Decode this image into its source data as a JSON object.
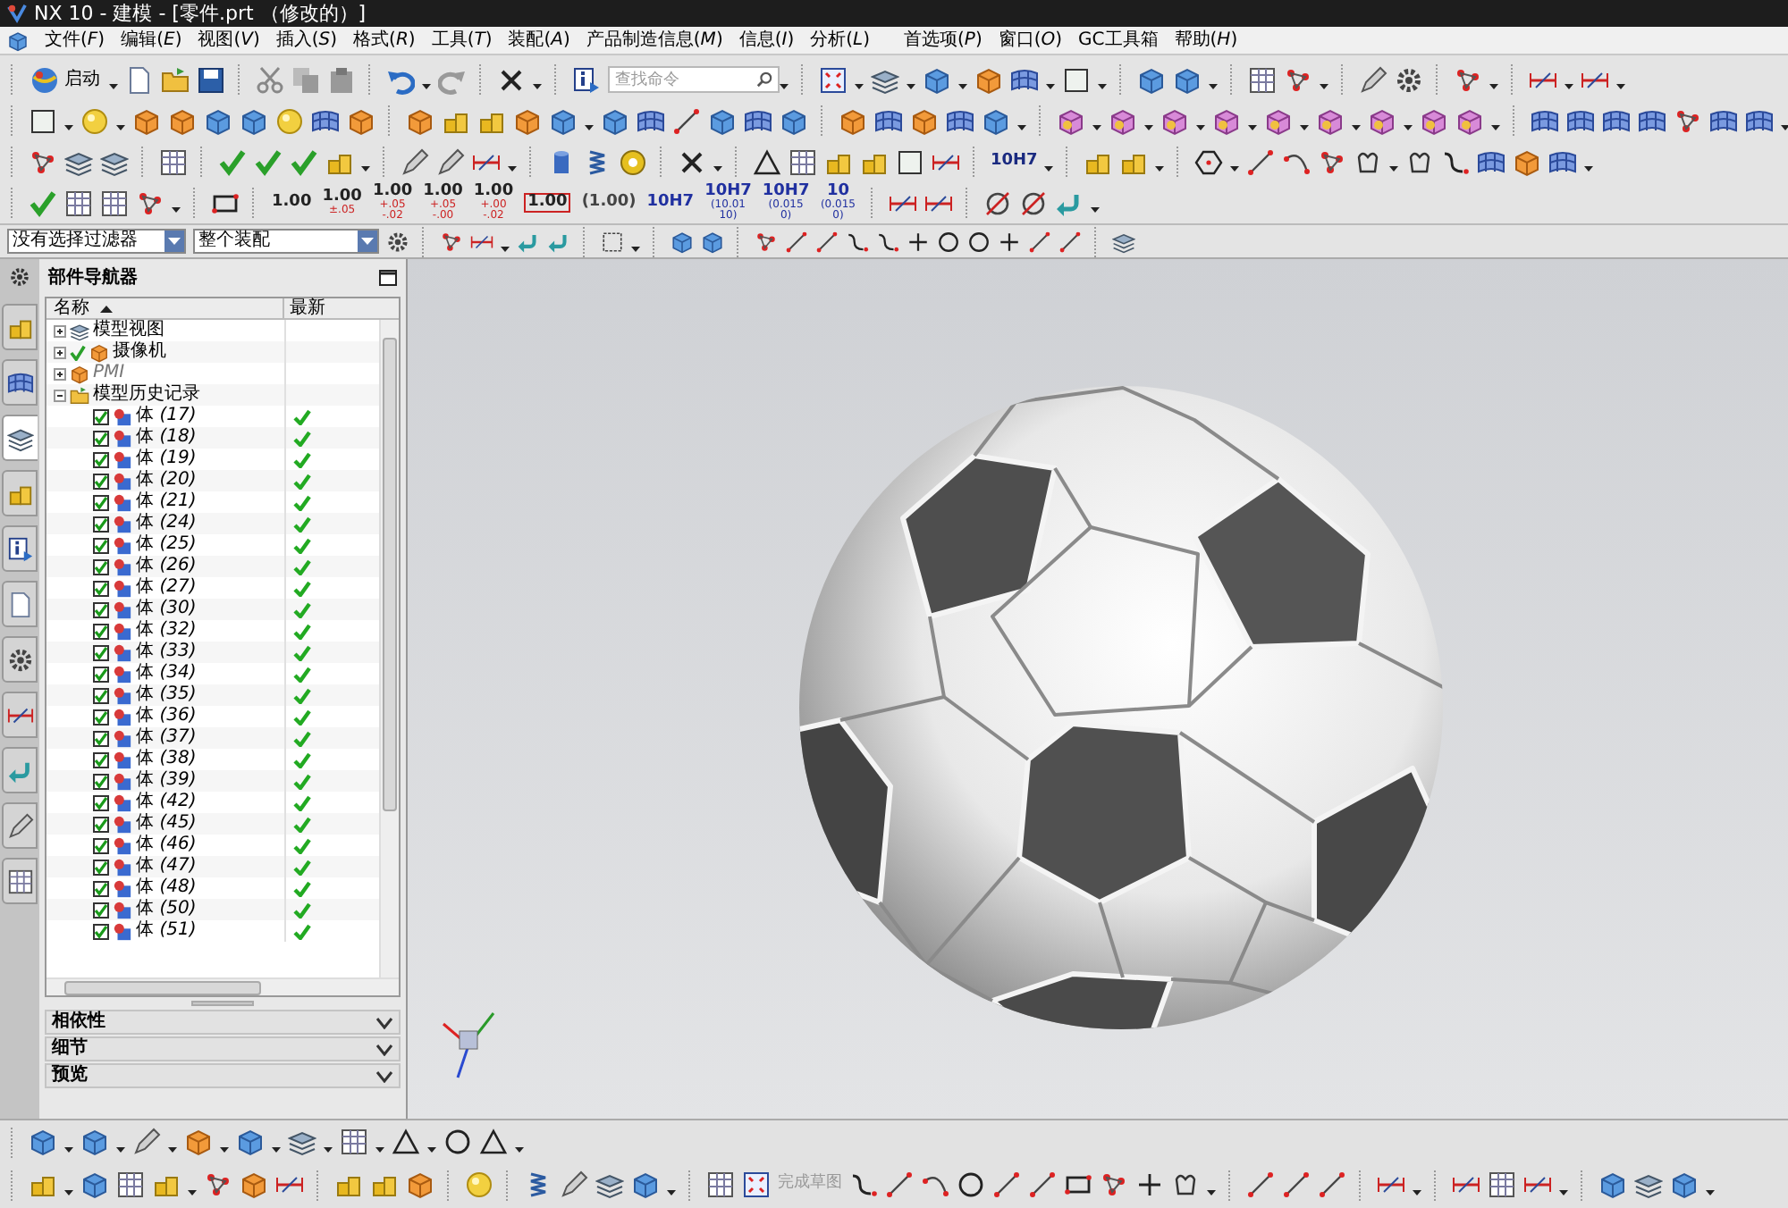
{
  "window": {
    "title": "NX 10 - 建模 - [零件.prt （修改的）]"
  },
  "menu": [
    "文件(*F*)",
    "编辑(*E*)",
    "视图(*V*)",
    "插入(*S*)",
    "格式(*R*)",
    "工具(*T*)",
    "装配(*A*)",
    "产品制造信息(*M*)",
    "信息(*I*)",
    "分析(*L*)",
    "首选项(*P*)",
    "窗口(*O*)",
    "GC工具箱",
    "帮助(*H*)"
  ],
  "toolbar": {
    "start_label": "启动",
    "search": {
      "placeholder": "查找命令"
    },
    "fit_label": "10H7"
  },
  "dimension_tools": [
    {
      "kind": "dimension",
      "value": "1.00"
    },
    {
      "kind": "dimension",
      "value": "1.00",
      "tolerance": "±.05"
    },
    {
      "kind": "dimension",
      "value": "1.00",
      "tolerance": "+.05 -.02"
    },
    {
      "kind": "dimension",
      "value": "1.00",
      "tolerance": "+.05 -.00"
    },
    {
      "kind": "dimension",
      "value": "1.00",
      "tolerance": "+.00 -.02"
    },
    {
      "kind": "basic",
      "value": "1.00"
    },
    {
      "kind": "reference",
      "value": "(1.00)"
    },
    {
      "kind": "fit",
      "value": "10H7"
    },
    {
      "kind": "fit",
      "value": "10H7",
      "tolerance": "(10.01 10)"
    },
    {
      "kind": "fit",
      "value": "10H7",
      "tolerance": "(0.015 0)"
    },
    {
      "kind": "fit",
      "value": "10",
      "tolerance": "(0.015 0)"
    }
  ],
  "filter_bar": {
    "selection_filter": "没有选择过滤器",
    "scope": "整个装配"
  },
  "side_tabs": [
    {
      "selected": false
    },
    {
      "selected": false
    },
    {
      "selected": true
    },
    {
      "selected": false
    },
    {
      "selected": false
    },
    {
      "selected": false
    },
    {
      "selected": false
    },
    {
      "selected": false
    },
    {
      "selected": false
    },
    {
      "selected": false
    },
    {
      "selected": false
    }
  ],
  "navigator": {
    "title": "部件导航器",
    "columns": [
      "名称",
      "最新"
    ],
    "tree": [
      {
        "label": "模型视图",
        "kind": "views",
        "expanded": false,
        "checked": false
      },
      {
        "label": "摄像机",
        "kind": "cameras",
        "expanded": false,
        "checked": true
      },
      {
        "label": "PMI",
        "kind": "pmi",
        "expanded": false,
        "checked": false
      },
      {
        "label": "模型历史记录",
        "kind": "history",
        "expanded": true,
        "checked": false,
        "children": [
          {
            "label": "体 *(17)*",
            "checked": true,
            "latest": true
          },
          {
            "label": "体 *(18)*",
            "checked": true,
            "latest": true
          },
          {
            "label": "体 *(19)*",
            "checked": true,
            "latest": true
          },
          {
            "label": "体 *(20)*",
            "checked": true,
            "latest": true
          },
          {
            "label": "体 *(21)*",
            "checked": true,
            "latest": true
          },
          {
            "label": "体 *(24)*",
            "checked": true,
            "latest": true
          },
          {
            "label": "体 *(25)*",
            "checked": true,
            "latest": true
          },
          {
            "label": "体 *(26)*",
            "checked": true,
            "latest": true
          },
          {
            "label": "体 *(27)*",
            "checked": true,
            "latest": true
          },
          {
            "label": "体 *(30)*",
            "checked": true,
            "latest": true
          },
          {
            "label": "体 *(32)*",
            "checked": true,
            "latest": true
          },
          {
            "label": "体 *(33)*",
            "checked": true,
            "latest": true
          },
          {
            "label": "体 *(34)*",
            "checked": true,
            "latest": true
          },
          {
            "label": "体 *(35)*",
            "checked": true,
            "latest": true
          },
          {
            "label": "体 *(36)*",
            "checked": true,
            "latest": true
          },
          {
            "label": "体 *(37)*",
            "checked": true,
            "latest": true
          },
          {
            "label": "体 *(38)*",
            "checked": true,
            "latest": true
          },
          {
            "label": "体 *(39)*",
            "checked": true,
            "latest": true
          },
          {
            "label": "体 *(42)*",
            "checked": true,
            "latest": true
          },
          {
            "label": "体 *(45)*",
            "checked": true,
            "latest": true
          },
          {
            "label": "体 *(46)*",
            "checked": true,
            "latest": true
          },
          {
            "label": "体 *(47)*",
            "checked": true,
            "latest": true
          },
          {
            "label": "体 *(48)*",
            "checked": true,
            "latest": true
          },
          {
            "label": "体 *(50)*",
            "checked": true,
            "latest": true
          },
          {
            "label": "体 *(51)*",
            "checked": true,
            "latest": true
          }
        ]
      }
    ],
    "sections": [
      {
        "label": "相依性",
        "expanded": false
      },
      {
        "label": "细节",
        "expanded": false
      },
      {
        "label": "预览",
        "expanded": false
      }
    ]
  },
  "bottom_toolbar": {
    "finish_sketch": {
      "label": "完成草图",
      "disabled": true
    }
  }
}
